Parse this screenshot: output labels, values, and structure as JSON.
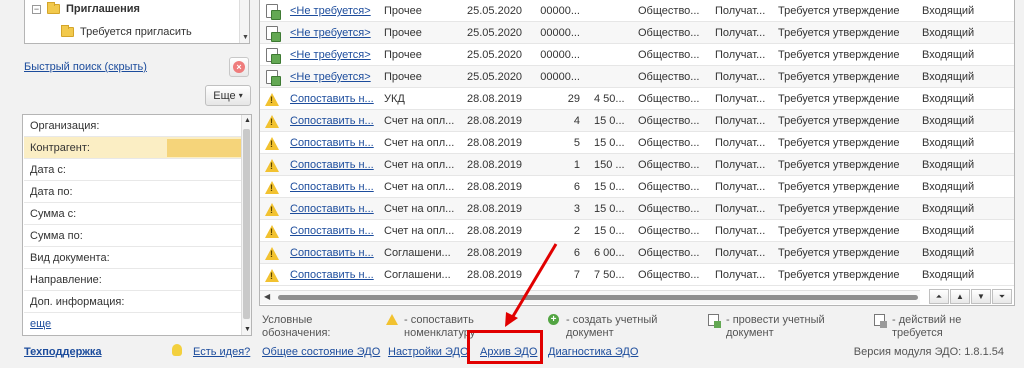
{
  "tree": {
    "items": [
      {
        "label": "Приглашения",
        "bold": true
      },
      {
        "label": "Требуется пригласить",
        "bold": false
      }
    ]
  },
  "quick_search": {
    "label": "Быстрый поиск (скрыть)"
  },
  "more_button": {
    "label": "Еще",
    "arrow": "▾"
  },
  "filters": {
    "fields": [
      {
        "label": "Организация:"
      },
      {
        "label": "Контрагент:"
      },
      {
        "label": "Дата с:"
      },
      {
        "label": "Дата по:"
      },
      {
        "label": "Сумма с:"
      },
      {
        "label": "Сумма по:"
      },
      {
        "label": "Вид документа:"
      },
      {
        "label": "Направление:"
      },
      {
        "label": "Доп. информация:"
      }
    ],
    "more_link": "еще"
  },
  "table": {
    "rows": [
      {
        "icon": "doc-green-icon",
        "action": "<Не требуется>",
        "type": "Прочее",
        "date": "25.05.2020",
        "num": "00000...",
        "sum": "",
        "org": "Общество...",
        "recipient": "Получат...",
        "status": "Требуется утверждение",
        "direction": "Входящий"
      },
      {
        "icon": "doc-green-icon",
        "action": "<Не требуется>",
        "type": "Прочее",
        "date": "25.05.2020",
        "num": "00000...",
        "sum": "",
        "org": "Общество...",
        "recipient": "Получат...",
        "status": "Требуется утверждение",
        "direction": "Входящий"
      },
      {
        "icon": "doc-green-icon",
        "action": "<Не требуется>",
        "type": "Прочее",
        "date": "25.05.2020",
        "num": "00000...",
        "sum": "",
        "org": "Общество...",
        "recipient": "Получат...",
        "status": "Требуется утверждение",
        "direction": "Входящий"
      },
      {
        "icon": "doc-green-icon",
        "action": "<Не требуется>",
        "type": "Прочее",
        "date": "25.05.2020",
        "num": "00000...",
        "sum": "",
        "org": "Общество...",
        "recipient": "Получат...",
        "status": "Требуется утверждение",
        "direction": "Входящий"
      },
      {
        "icon": "warning-icon",
        "action": "Сопоставить н...",
        "type": "УКД",
        "date": "28.08.2019",
        "num": "29",
        "sum": "4 50...",
        "org": "Общество...",
        "recipient": "Получат...",
        "status": "Требуется утверждение",
        "direction": "Входящий"
      },
      {
        "icon": "warning-icon",
        "action": "Сопоставить н...",
        "type": "Счет на опл...",
        "date": "28.08.2019",
        "num": "4",
        "sum": "15 0...",
        "org": "Общество...",
        "recipient": "Получат...",
        "status": "Требуется утверждение",
        "direction": "Входящий"
      },
      {
        "icon": "warning-icon",
        "action": "Сопоставить н...",
        "type": "Счет на опл...",
        "date": "28.08.2019",
        "num": "5",
        "sum": "15 0...",
        "org": "Общество...",
        "recipient": "Получат...",
        "status": "Требуется утверждение",
        "direction": "Входящий"
      },
      {
        "icon": "warning-icon",
        "action": "Сопоставить н...",
        "type": "Счет на опл...",
        "date": "28.08.2019",
        "num": "1",
        "sum": "150 ...",
        "org": "Общество...",
        "recipient": "Получат...",
        "status": "Требуется утверждение",
        "direction": "Входящий"
      },
      {
        "icon": "warning-icon",
        "action": "Сопоставить н...",
        "type": "Счет на опл...",
        "date": "28.08.2019",
        "num": "6",
        "sum": "15 0...",
        "org": "Общество...",
        "recipient": "Получат...",
        "status": "Требуется утверждение",
        "direction": "Входящий"
      },
      {
        "icon": "warning-icon",
        "action": "Сопоставить н...",
        "type": "Счет на опл...",
        "date": "28.08.2019",
        "num": "3",
        "sum": "15 0...",
        "org": "Общество...",
        "recipient": "Получат...",
        "status": "Требуется утверждение",
        "direction": "Входящий"
      },
      {
        "icon": "warning-icon",
        "action": "Сопоставить н...",
        "type": "Счет на опл...",
        "date": "28.08.2019",
        "num": "2",
        "sum": "15 0...",
        "org": "Общество...",
        "recipient": "Получат...",
        "status": "Требуется утверждение",
        "direction": "Входящий"
      },
      {
        "icon": "warning-icon",
        "action": "Сопоставить н...",
        "type": "Соглашени...",
        "date": "28.08.2019",
        "num": "6",
        "sum": "6 00...",
        "org": "Общество...",
        "recipient": "Получат...",
        "status": "Требуется утверждение",
        "direction": "Входящий"
      },
      {
        "icon": "warning-icon",
        "action": "Сопоставить н...",
        "type": "Соглашени...",
        "date": "28.08.2019",
        "num": "7",
        "sum": "7 50...",
        "org": "Общество...",
        "recipient": "Получат...",
        "status": "Требуется утверждение",
        "direction": "Входящий"
      }
    ],
    "nav_buttons": [
      "⏶",
      "▲",
      "▼",
      "⏷"
    ]
  },
  "legend": {
    "title_1": "Условные",
    "title_2": "обозначения:",
    "items": [
      {
        "icon": "warning-icon",
        "line1": "- сопоставить",
        "line2": "номенклатуру"
      },
      {
        "icon": "plus-circle-icon",
        "line1": "- создать учетный",
        "line2": "документ"
      },
      {
        "icon": "doc-green-icon",
        "line1": "- провести учетный",
        "line2": "документ"
      },
      {
        "icon": "doc-grey-icon",
        "line1": "- действий не",
        "line2": "требуется"
      }
    ]
  },
  "footer": {
    "support": "Техподдержка",
    "idea": "Есть идея?",
    "state": "Общее состояние ЭДО",
    "settings": "Настройки ЭДО",
    "archive": "Архив ЭДО",
    "diagnostics": "Диагностика ЭДО",
    "version": "Версия модуля ЭДО: 1.8.1.54"
  },
  "colors": {
    "highlight": "#e10000",
    "link": "#1c4c9c",
    "active_filter": "#f5d47a"
  }
}
